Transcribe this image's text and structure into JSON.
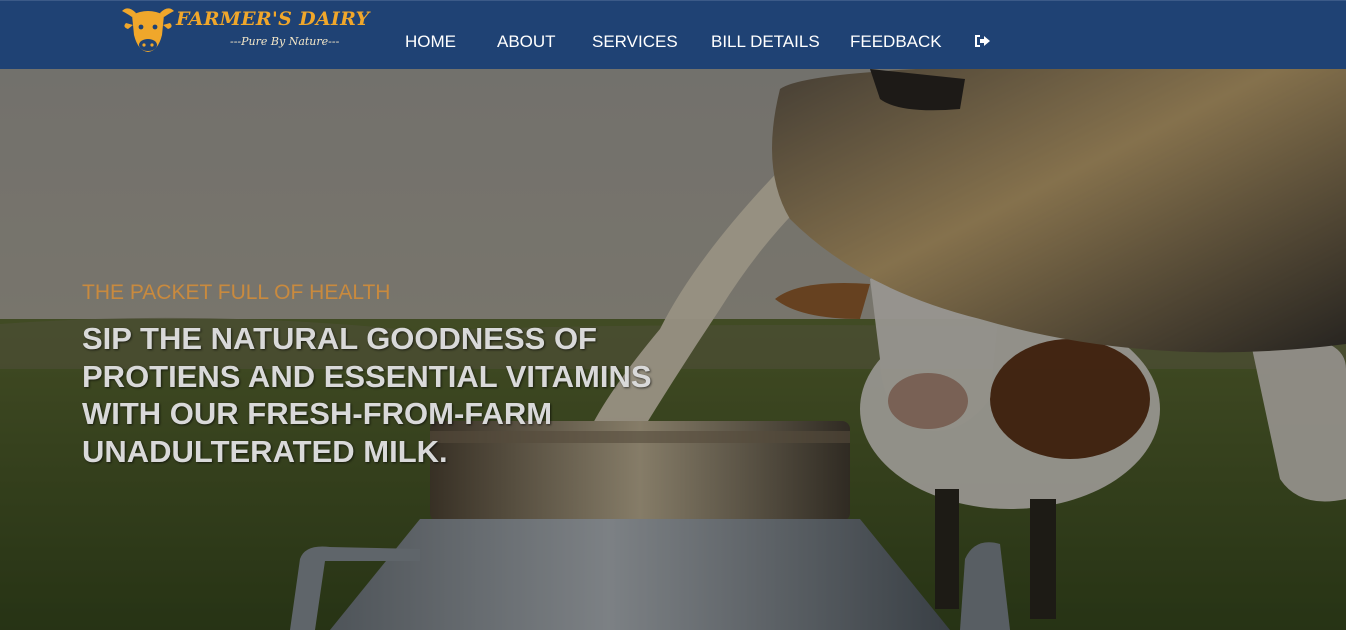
{
  "brand": {
    "name": "FARMER'S DAIRY",
    "tagline": "---Pure By Nature---",
    "logo_icon": "cow-head-icon",
    "accent_color": "#f0a72b"
  },
  "nav": {
    "background": "#1f4274",
    "items": [
      {
        "label": "HOME"
      },
      {
        "label": "ABOUT"
      },
      {
        "label": "SERVICES"
      },
      {
        "label": "BILL DETAILS"
      },
      {
        "label": "FEEDBACK"
      }
    ],
    "logout_icon": "sign-out-icon"
  },
  "hero": {
    "subtitle": "THE PACKET FULL OF HEALTH",
    "headline": "SIP THE NATURAL GOODNESS OF PROTIENS AND ESSENTIAL VITAMINS WITH OUR FRESH-FROM-FARM UNADULTERATED MILK.",
    "subtitle_color": "#c98a3e",
    "background_image": "milk-pouring-into-can-with-cow-photo"
  }
}
